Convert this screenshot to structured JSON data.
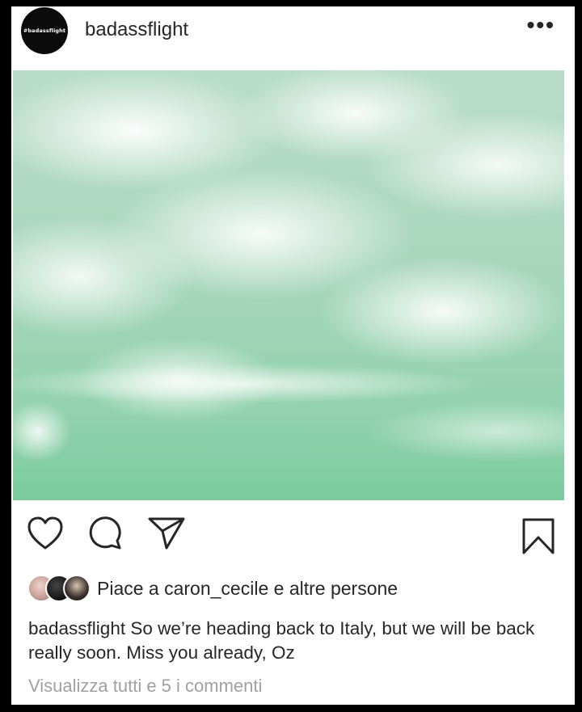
{
  "post": {
    "username": "badassflight",
    "avatar_text": "#badassflight",
    "more_icon": "more-options-icon",
    "image_alt": "Aerial view of white sea foam on turquoise water",
    "actions": {
      "like_icon": "heart-icon",
      "comment_icon": "comment-icon",
      "share_icon": "share-send-icon",
      "save_icon": "bookmark-icon"
    },
    "likes": {
      "prefix": "Piace a",
      "user": "caron_cecile",
      "connector": "e",
      "others": "altre persone"
    },
    "caption": {
      "author": "badassflight",
      "text": "So we’re heading back to Italy, but we will be back really soon. Miss you already, Oz"
    },
    "view_comments": "Visualizza tutti e 5 i commenti"
  },
  "colors": {
    "text": "#262626",
    "muted": "#a0a0a0",
    "water": "#93d2ae"
  }
}
